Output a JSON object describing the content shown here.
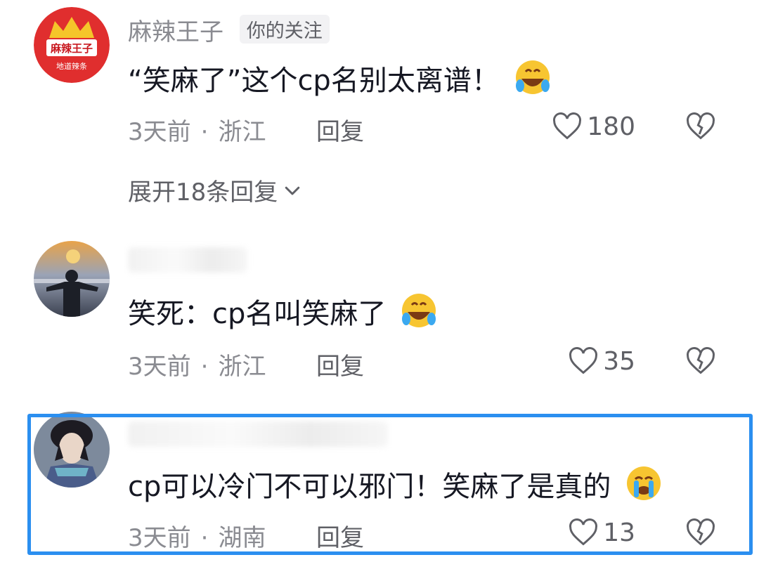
{
  "comments": [
    {
      "username": "麻辣王子",
      "tag": "你的关注",
      "avatar_text_top": "麻辣王子",
      "avatar_text_bottom": "地道辣条",
      "text": "“笑麻了”这个cp名别太离谱！",
      "emoji": "rofl-emoji",
      "time": "3天前",
      "location": "浙江",
      "reply_label": "回复",
      "likes": "180",
      "expand_label": "展开18条回复"
    },
    {
      "username": "",
      "text": "笑死：cp名叫笑麻了",
      "emoji": "rofl-emoji",
      "time": "3天前",
      "location": "浙江",
      "reply_label": "回复",
      "likes": "35"
    },
    {
      "username": "",
      "text": "cp可以冷门不可以邪门！笑麻了是真的",
      "emoji": "crying-emoji",
      "time": "3天前",
      "location": "湖南",
      "reply_label": "回复",
      "likes": "13"
    }
  ],
  "colors": {
    "highlight": "#2b8ff0",
    "brand_red": "#e02e2e",
    "brand_gold": "#f5c52a",
    "meta_gray": "#8a8b91"
  }
}
